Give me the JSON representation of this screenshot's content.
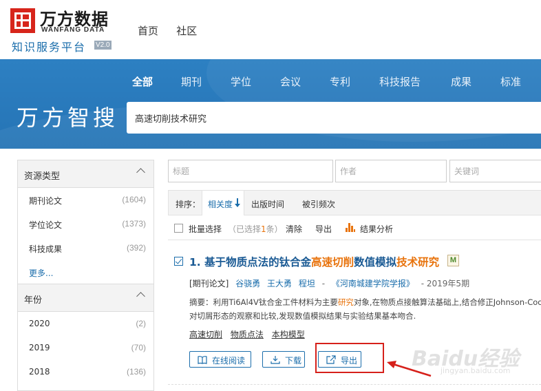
{
  "header": {
    "brand_cn": "万方数据",
    "brand_en": "WANFANG DATA",
    "brand_sub": "知识服务平台",
    "version": "V2.0",
    "nav": [
      "首页",
      "社区"
    ]
  },
  "banner": {
    "tabs": [
      "全部",
      "期刊",
      "学位",
      "会议",
      "专利",
      "科技报告",
      "成果",
      "标准"
    ],
    "search_title": "万方智搜",
    "query": "高速切削技术研究"
  },
  "sidebar": {
    "resource_type": {
      "title": "资源类型",
      "items": [
        {
          "label": "期刊论文",
          "count": "(1604)"
        },
        {
          "label": "学位论文",
          "count": "(1373)"
        },
        {
          "label": "科技成果",
          "count": "(392)"
        }
      ],
      "more": "更多..."
    },
    "year": {
      "title": "年份",
      "items": [
        {
          "label": "2020",
          "count": "(2)"
        },
        {
          "label": "2019",
          "count": "(70)"
        },
        {
          "label": "2018",
          "count": "(136)"
        }
      ]
    }
  },
  "filters": {
    "title_placeholder": "标题",
    "author_placeholder": "作者",
    "keyword_placeholder": "关键词"
  },
  "sort": {
    "label": "排序：",
    "relevance": "相关度",
    "pub_time": "出版时间",
    "cited": "被引频次"
  },
  "batch": {
    "select": "批量选择",
    "selected_prefix": "（已选择",
    "selected_count": "1",
    "selected_suffix": "条）",
    "clear": "清除",
    "export": "导出",
    "analysis": "结果分析"
  },
  "result": {
    "title_a": "1. 基于物质点法的钛合金",
    "title_b": "高速切削",
    "title_c": "数值模拟",
    "title_d": "技术研究",
    "m_icon": "M",
    "type": "[期刊论文]",
    "authors": [
      "谷骁勇",
      "王大勇",
      "程坦"
    ],
    "sep": "-",
    "journal": "《河南城建学院学报》",
    "date": "- 2019年5期",
    "abstract_a": "摘要：利用Ti6Al4V钛合金工件材料为主要",
    "abstract_hl": "研究",
    "abstract_b": "对象,在物质点接触算法基础上,结合修正Johnson-Cook",
    "abstract_line2": "对切屑形态的观察和比较,发现数值模拟结果与实验结果基本吻合.",
    "keywords": [
      "高速切削",
      "物质点法",
      "本构模型"
    ],
    "buttons": {
      "read": "在线阅读",
      "download": "下载",
      "export": "导出"
    }
  },
  "watermark": {
    "main": "Baidu经验",
    "sub": "jingyan.baidu.com"
  },
  "colors": {
    "brand_red": "#d7251b",
    "link_blue": "#1a6dab",
    "highlight_orange": "#e8730c",
    "banner_blue": "#2a7bbd",
    "annotation_red": "#d6201a"
  }
}
